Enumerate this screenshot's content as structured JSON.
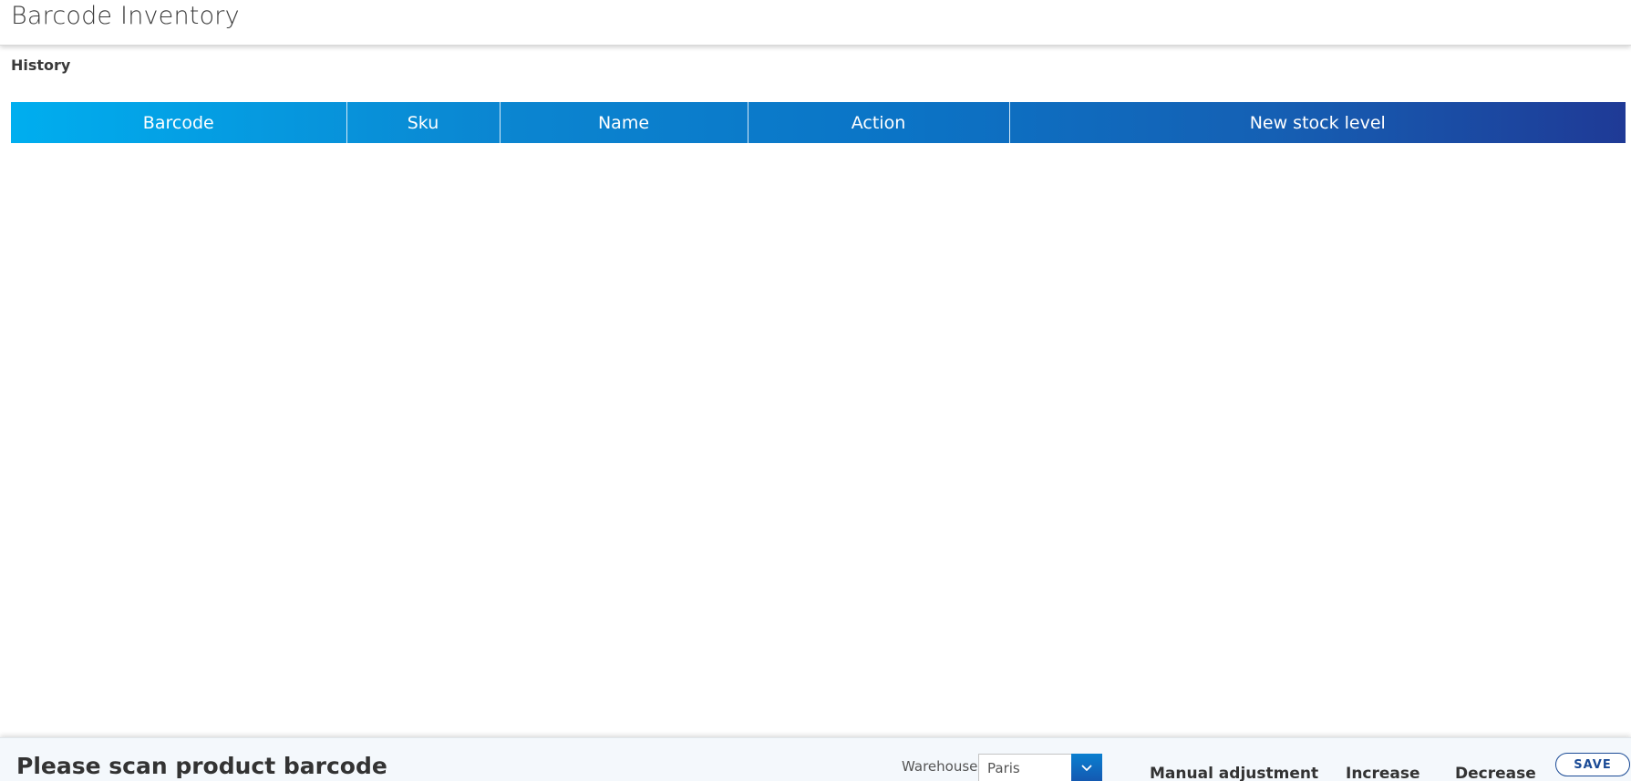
{
  "header": {
    "title": "Barcode Inventory"
  },
  "history": {
    "label": "History",
    "columns": [
      "Barcode",
      "Sku",
      "Name",
      "Action",
      "New stock level"
    ]
  },
  "bottom_bar": {
    "scan_prompt": "Please scan product barcode",
    "warehouse_label": "Warehouse",
    "warehouse_value": "Paris",
    "manual_adjustment": "Manual adjustment",
    "increase": "Increase",
    "decrease": "Decrease",
    "save": "SAVE"
  },
  "icons": {
    "dropdown": "chevron-down-icon"
  },
  "colors": {
    "table_header_start": "#00aeef",
    "table_header_end": "#1f3a96",
    "save_border": "#1b4b96"
  }
}
